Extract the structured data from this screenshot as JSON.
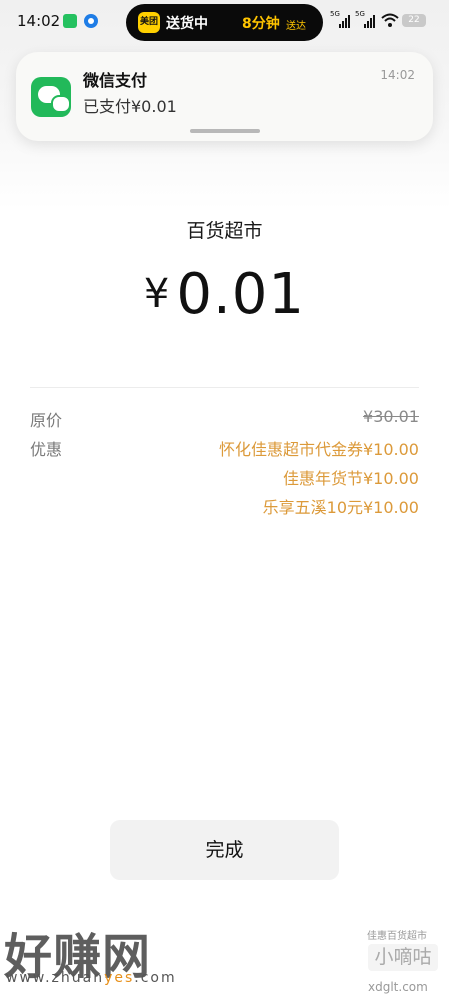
{
  "status_bar": {
    "time": "14:02",
    "island_badge": "美团",
    "island_status": "送货中",
    "island_eta": "8分钟",
    "island_eta_suffix": "送达",
    "signal_1": "5G",
    "signal_2": "5G",
    "battery": "22"
  },
  "notification": {
    "app": "微信支付",
    "message": "已支付¥0.01",
    "time": "14:02"
  },
  "payment": {
    "merchant": "百货超市",
    "currency_symbol": "¥",
    "amount": "0.01"
  },
  "details": {
    "original_label": "原价",
    "original_price": "¥30.01",
    "discount_label": "优惠",
    "discounts": [
      "怀化佳惠超市代金券¥10.00",
      "佳惠年货节¥10.00",
      "乐享五溪10元¥10.00"
    ]
  },
  "actions": {
    "done_label": "完成"
  },
  "watermarks": {
    "left_logo": "好赚网",
    "left_url_a": "www.zhuan",
    "left_url_b": "yes",
    "left_url_c": ".com",
    "right_line1": "佳惠百货超市",
    "right_logo": "小嘀咕",
    "right_url": "xdglt.com"
  },
  "colors": {
    "discount": "#dc9a3a",
    "wechat_green": "#22b95a",
    "meituan_yellow": "#ffd000"
  }
}
